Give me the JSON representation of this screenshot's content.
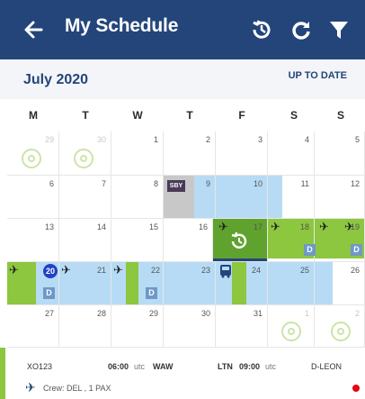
{
  "header": {
    "title": "My Schedule",
    "back_icon": "arrow-left-icon",
    "icons": [
      "history-icon",
      "refresh-icon",
      "filter-icon"
    ],
    "bg": "#23457a"
  },
  "month_bar": {
    "month": "July 2020",
    "sync_status": "UP TO DATE"
  },
  "weekdays": [
    "M",
    "T",
    "W",
    "T",
    "F",
    "S",
    "S"
  ],
  "weeks": [
    [
      "29",
      "30",
      "1",
      "2",
      "3",
      "4",
      "5"
    ],
    [
      "6",
      "7",
      "8",
      "9",
      "10",
      "11",
      "12"
    ],
    [
      "13",
      "14",
      "15",
      "16",
      "17",
      "18",
      "19"
    ],
    [
      "20",
      "21",
      "22",
      "23",
      "24",
      "25",
      "26"
    ],
    [
      "27",
      "28",
      "29",
      "30",
      "31",
      "1",
      "2"
    ]
  ],
  "badges": {
    "duty_code": "D",
    "standby": "SBY"
  },
  "colors": {
    "flight_green": "#8dc63f",
    "duty_blue": "#b7dbf5",
    "today_red": "#e30613",
    "current_day": "#2340c7"
  },
  "footer": {
    "flight_number": "XO123",
    "dep_time": "06:00",
    "dep_tz": "utc",
    "dep_airport": "WAW",
    "arr_airport": "LTN",
    "arr_time": "09:00",
    "arr_tz": "utc",
    "aircraft": "D-LEON",
    "crew_label": "Crew: DEL , 1 PAX"
  }
}
